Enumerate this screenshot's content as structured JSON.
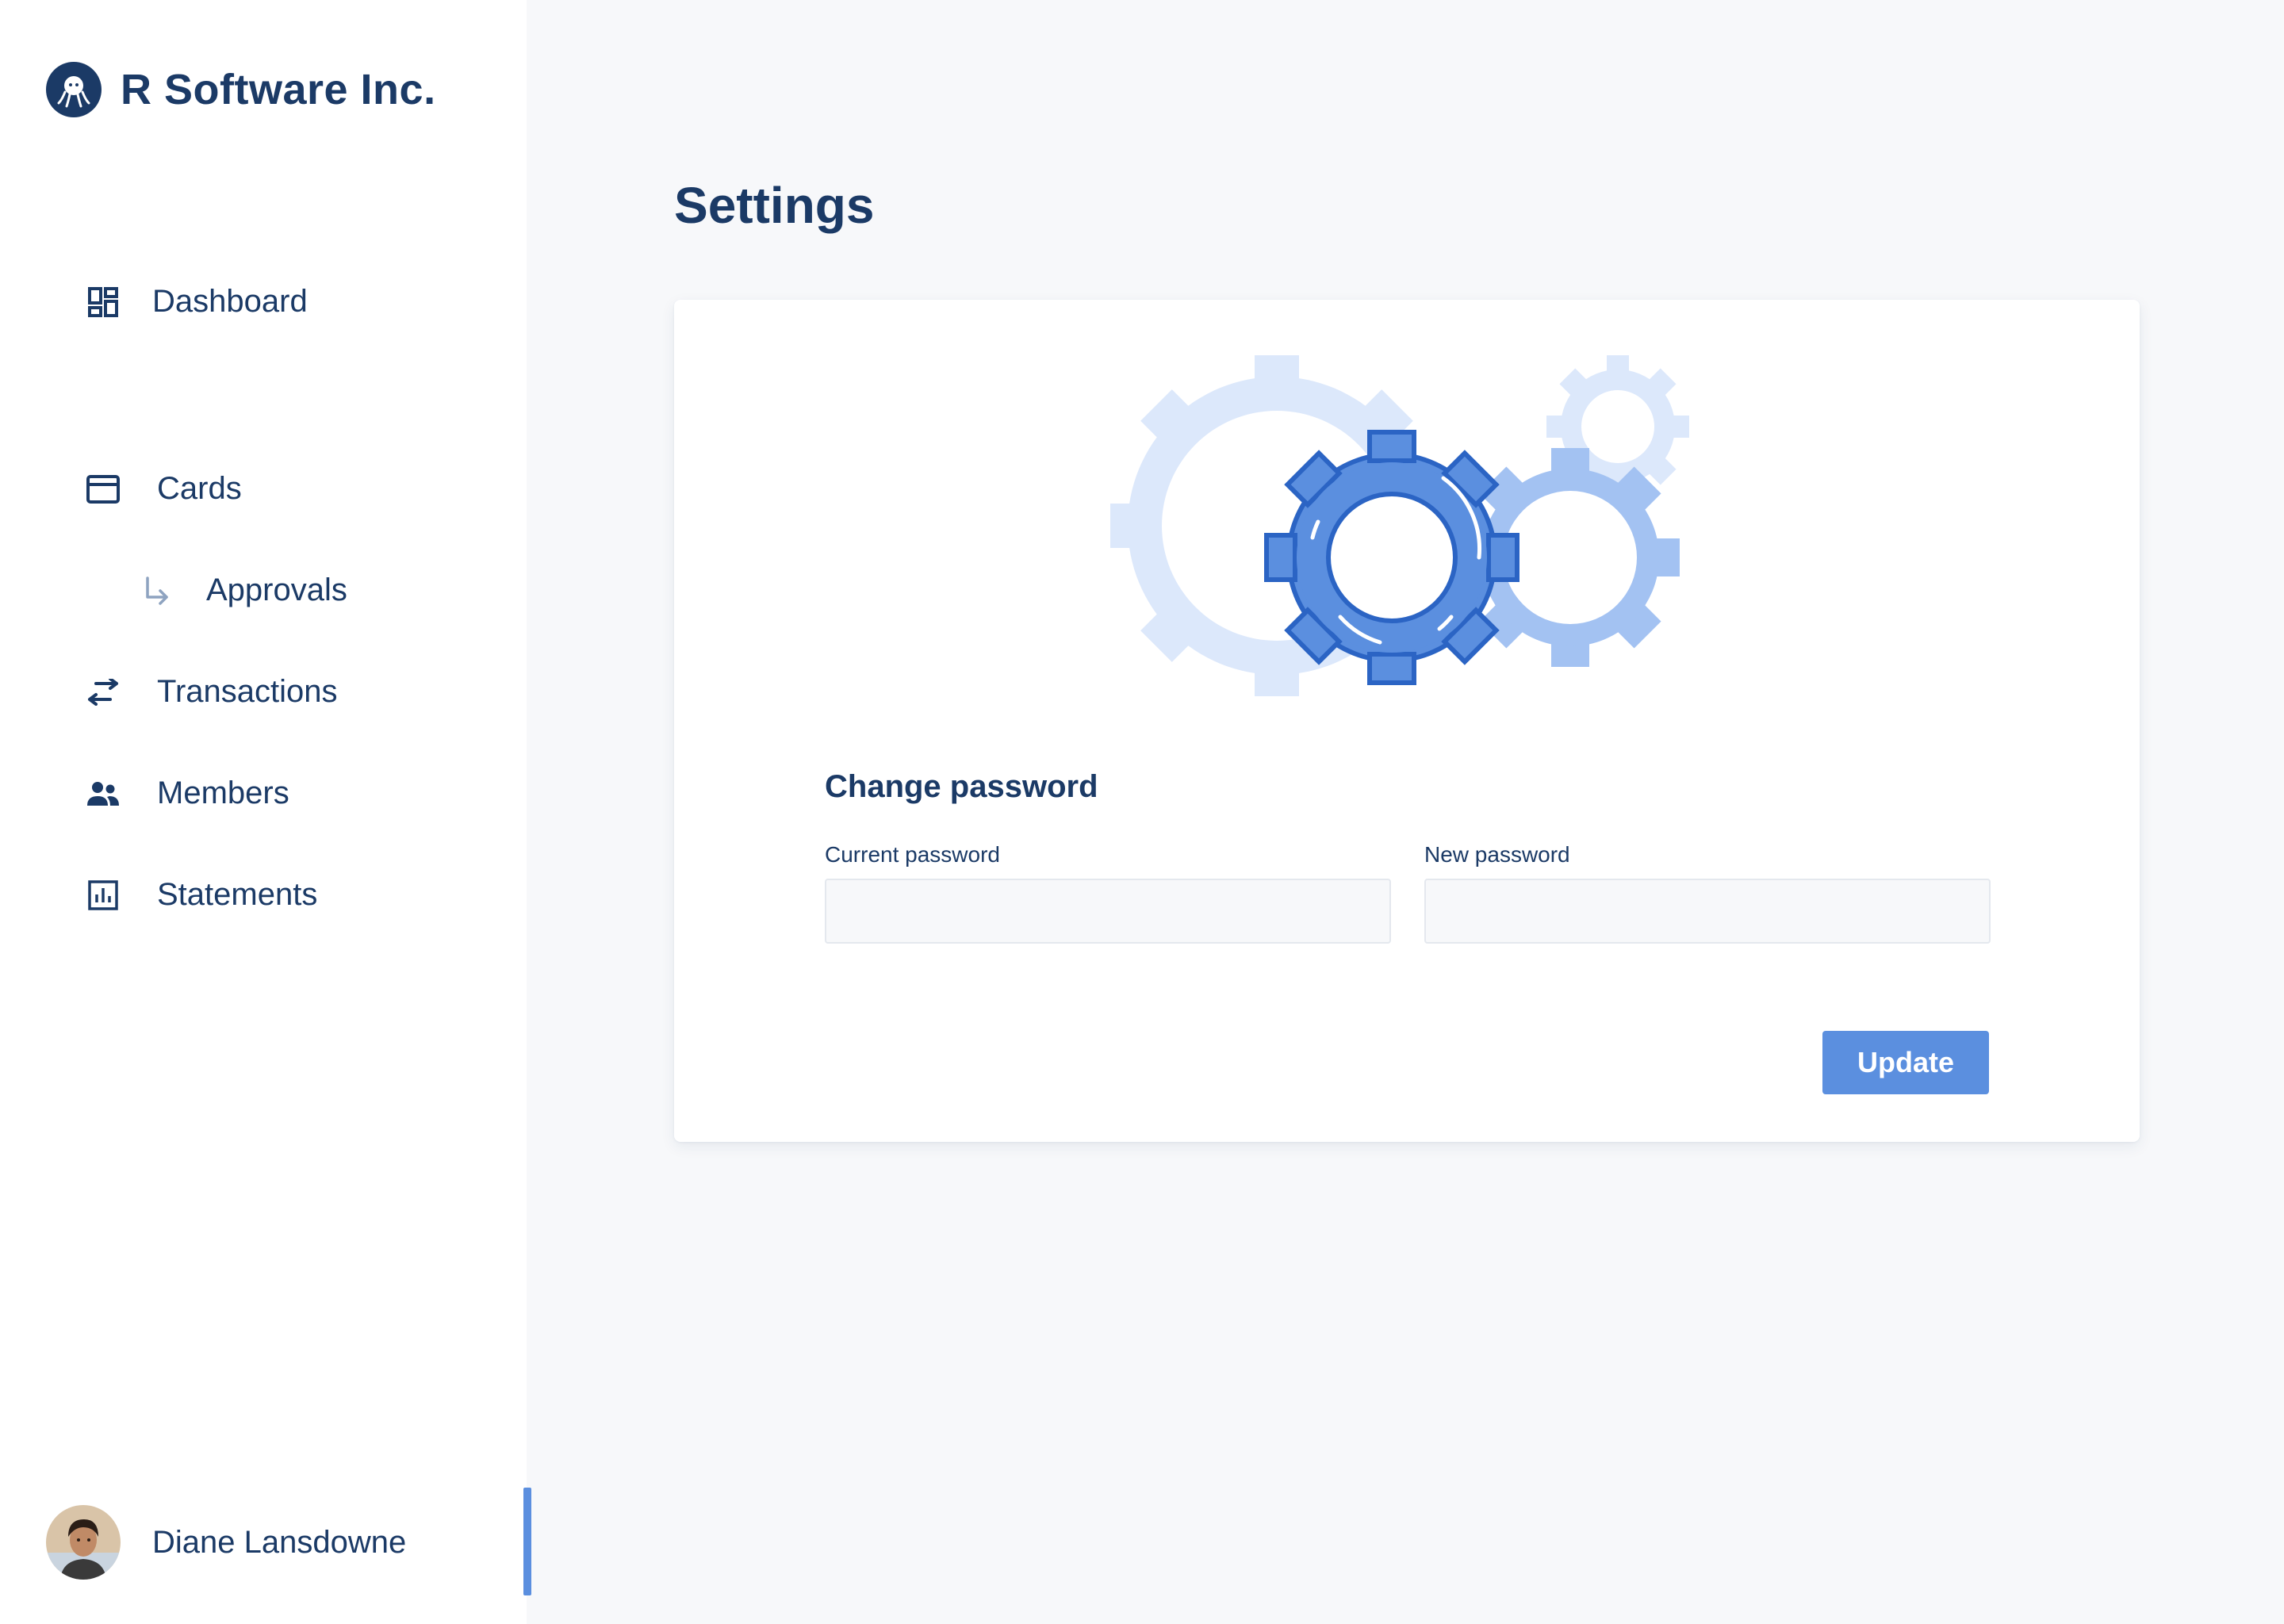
{
  "brand": {
    "name": "R Software Inc."
  },
  "sidebar": {
    "items": [
      {
        "label": "Dashboard",
        "icon": "dashboard-icon"
      },
      {
        "label": "Cards",
        "icon": "credit-card-icon"
      },
      {
        "label": "Approvals",
        "icon": "subdirectory-arrow-icon"
      },
      {
        "label": "Transactions",
        "icon": "swap-arrows-icon"
      },
      {
        "label": "Members",
        "icon": "people-icon"
      },
      {
        "label": "Statements",
        "icon": "bar-chart-icon"
      }
    ]
  },
  "user": {
    "name": "Diane Lansdowne"
  },
  "main": {
    "title": "Settings",
    "section_title": "Change password",
    "current_password_label": "Current password",
    "new_password_label": "New password",
    "current_password_value": "",
    "new_password_value": "",
    "update_label": "Update"
  },
  "colors": {
    "navy": "#1b3a66",
    "accent": "#5b8fdf",
    "background": "#f7f8fa"
  }
}
